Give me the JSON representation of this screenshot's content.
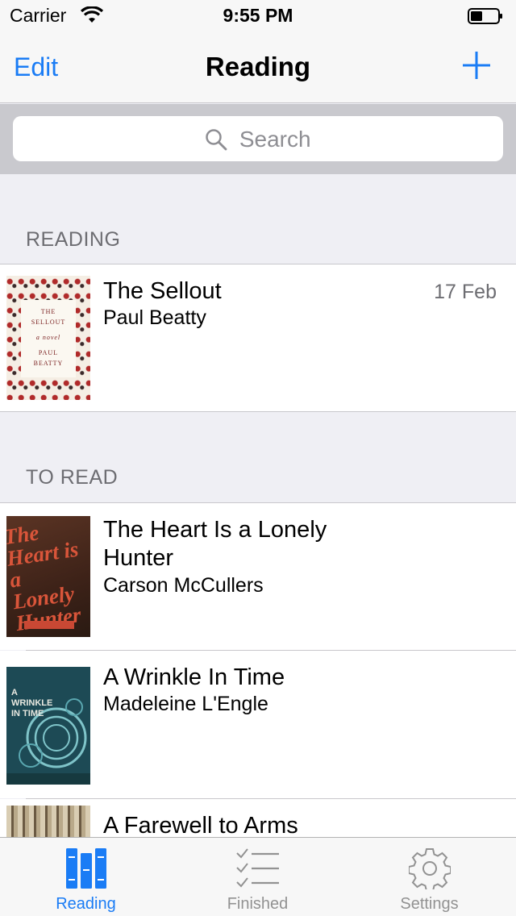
{
  "status_bar": {
    "carrier": "Carrier",
    "time": "9:55 PM"
  },
  "nav": {
    "edit_label": "Edit",
    "title": "Reading",
    "add_icon": "plus-icon"
  },
  "search": {
    "placeholder": "Search",
    "icon": "search-icon"
  },
  "sections": [
    {
      "header": "READING",
      "books": [
        {
          "title": "The Sellout",
          "author": "Paul Beatty",
          "date": "17 Feb",
          "cover_text": [
            "THE",
            "SELLOUT",
            "a novel",
            "PAUL",
            "BEATTY"
          ]
        }
      ]
    },
    {
      "header": "TO READ",
      "books": [
        {
          "title": "The Heart Is a Lonely Hunter",
          "author": "Carson McCullers",
          "cover_text": "The Heart is a Lonely Hunter"
        },
        {
          "title": "A Wrinkle In Time",
          "author": "Madeleine L'Engle",
          "cover_text": "A WRINKLE IN TIME"
        },
        {
          "title": "A Farewell to Arms",
          "author": ""
        }
      ]
    }
  ],
  "tabs": [
    {
      "label": "Reading",
      "icon": "books-icon",
      "active": true
    },
    {
      "label": "Finished",
      "icon": "checklist-icon",
      "active": false
    },
    {
      "label": "Settings",
      "icon": "gear-icon",
      "active": false
    }
  ],
  "colors": {
    "accent": "#1a7cf5",
    "inactive_tab": "#929292",
    "section_header_text": "#6d6d72",
    "background": "#efeff4"
  }
}
